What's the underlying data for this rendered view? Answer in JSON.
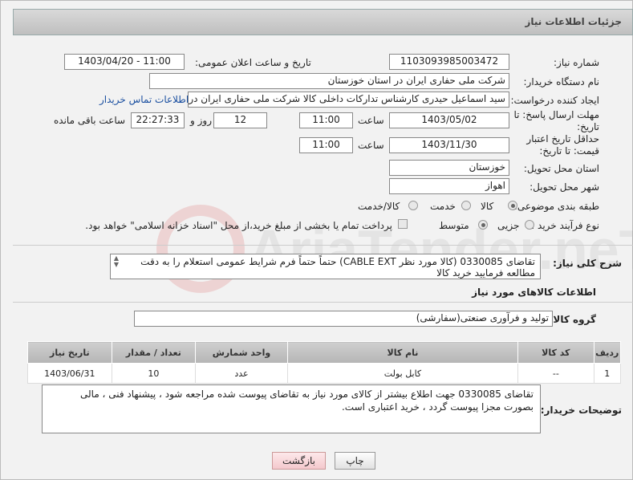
{
  "header": {
    "title": "جزئیات اطلاعات نیاز"
  },
  "form": {
    "need_number_label": "شماره نیاز:",
    "need_number": "1103093985003472",
    "announce_label": "تاریخ و ساعت اعلان عمومی:",
    "announce_value": "1403/04/20 - 11:00",
    "buyer_org_label": "نام دستگاه خریدار:",
    "buyer_org": "شرکت ملی حفاری ایران در استان خوزستان",
    "requester_label": "ایجاد کننده درخواست:",
    "requester": "سید اسماعیل حیدری کارشناس تدارکات داخلی کالا شرکت ملی حفاری ایران در",
    "contact_link": "اطلاعات تماس خریدار",
    "deadline_label": "مهلت ارسال پاسخ: تا تاریخ:",
    "deadline_date": "1403/05/02",
    "time_label": "ساعت",
    "deadline_time": "11:00",
    "days_value": "12",
    "days_label": "روز و",
    "remaining_time": "22:27:33",
    "remaining_label": "ساعت باقی مانده",
    "price_validity_label": "حداقل تاریخ اعتبار قیمت: تا تاریخ:",
    "price_validity_date": "1403/11/30",
    "price_validity_time": "11:00",
    "province_label": "استان محل تحویل:",
    "province": "خوزستان",
    "city_label": "شهر محل تحویل:",
    "city": "اهواز",
    "category_label": "طبقه بندی موضوعی:",
    "category_options": [
      "کالا",
      "خدمت",
      "کالا/خدمت"
    ],
    "category_selected": "کالا",
    "process_label": "نوع فرآیند خرید :",
    "process_options": [
      "جزیی",
      "متوسط"
    ],
    "process_selected": "متوسط",
    "payment_note": "پرداخت تمام یا بخشی از مبلغ خرید،از محل \"اسناد خزانه اسلامی\" خواهد بود."
  },
  "description": {
    "label": "شرح کلی نیاز:",
    "text": "تقاضای 0330085 (کالا مورد نظر CABLE EXT) حتماً حتماً فرم شرایط عمومی استعلام را به دقت مطالعه فرمایید خرید کالا"
  },
  "goods": {
    "section_title": "اطلاعات کالاهای مورد نیاز",
    "group_label": "گروه کالا:",
    "group_value": "تولید و فرآوری صنعتی(سفارشی)",
    "columns": [
      "ردیف",
      "کد کالا",
      "نام کالا",
      "واحد شمارش",
      "تعداد / مقدار",
      "تاریخ نیاز"
    ],
    "rows": [
      [
        "1",
        "--",
        "کابل بولت",
        "عدد",
        "10",
        "1403/06/31"
      ]
    ]
  },
  "buyer_notes": {
    "label": "توضیحات خریدار:",
    "text": "تقاضای 0330085 جهت اطلاع بیشتر از کالای مورد نیاز به تقاضای پیوست شده مراجعه شود ، پیشنهاد فنی ، مالی بصورت مجزا پیوست  گردد ، خرید اعتباری است."
  },
  "buttons": {
    "print": "چاپ",
    "back": "بازگشت"
  },
  "watermark": {
    "text": "AriaTender.neT"
  }
}
